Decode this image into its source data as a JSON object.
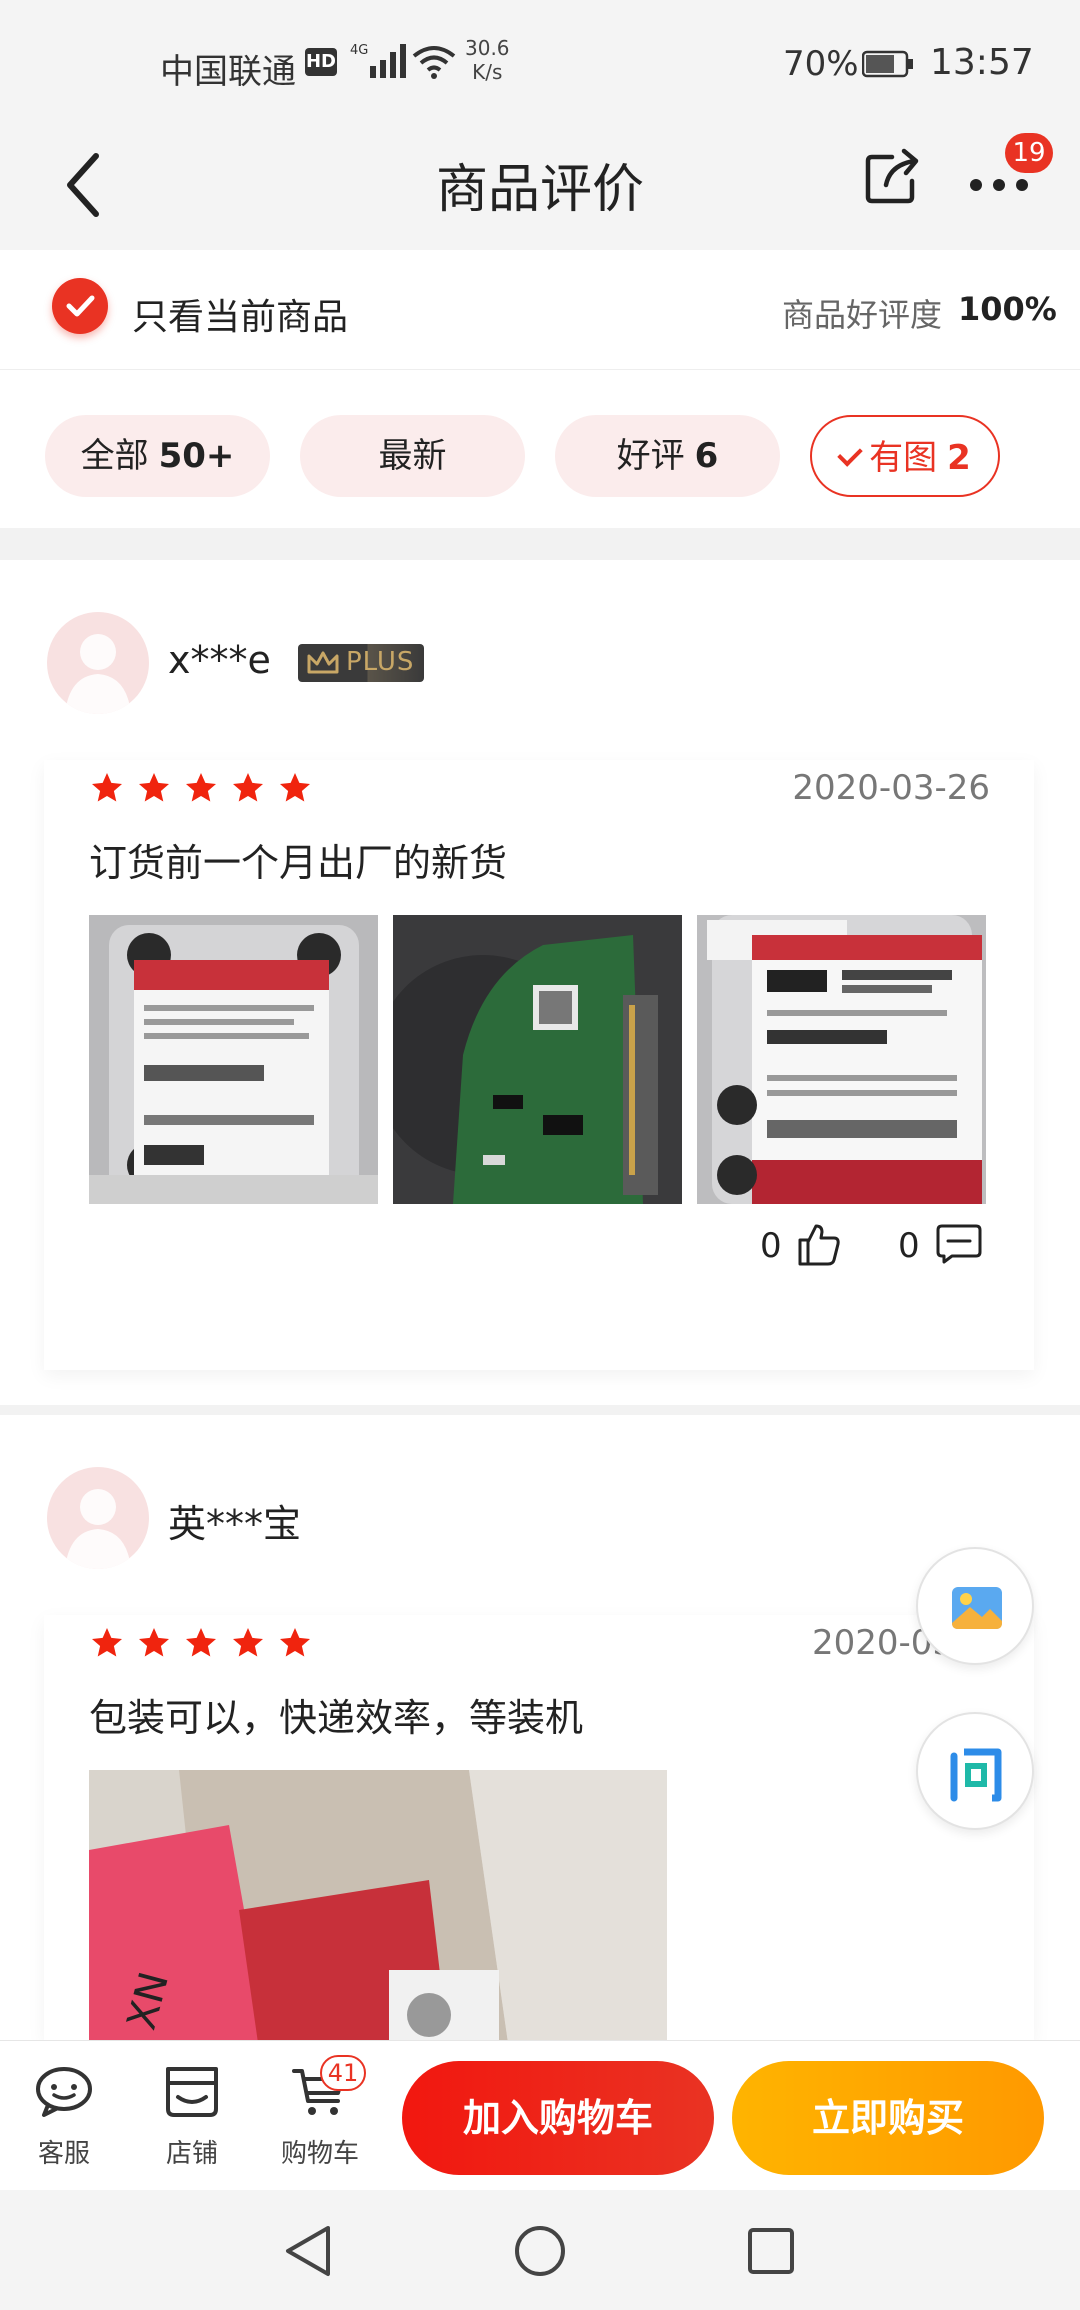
{
  "status_bar": {
    "carrier": "中国联通",
    "hd": "HD",
    "network": "4G",
    "speed_value": "30.6",
    "speed_unit": "K/s",
    "battery_pct": "70%",
    "time": "13:57"
  },
  "navbar": {
    "title": "商品评价",
    "more_badge": "19"
  },
  "filter": {
    "only_current_label": "只看当前商品",
    "good_rate_label": "商品好评度",
    "good_rate_value": "100%"
  },
  "tabs": [
    {
      "label": "全部",
      "count": "50+",
      "active": false
    },
    {
      "label": "最新",
      "count": "",
      "active": false
    },
    {
      "label": "好评",
      "count": "6",
      "active": false
    },
    {
      "label": "有图",
      "count": "2",
      "active": true
    }
  ],
  "reviews": [
    {
      "user": "x***e",
      "plus_badge": "PLUS",
      "stars": 5,
      "date": "2020-03-26",
      "text": "订货前一个月出厂的新货",
      "likes": "0",
      "comments": "0"
    },
    {
      "user": "英***宝",
      "stars": 5,
      "date": "2020-03",
      "text": "包装可以，快递效率，等装机"
    }
  ],
  "bottom_bar": {
    "service_label": "客服",
    "shop_label": "店铺",
    "cart_label": "购物车",
    "cart_badge": "41",
    "add_cart_label": "加入购物车",
    "buy_now_label": "立即购买"
  },
  "colors": {
    "accent": "#e93323",
    "buy": "#ff9900",
    "star": "#f0240e"
  }
}
